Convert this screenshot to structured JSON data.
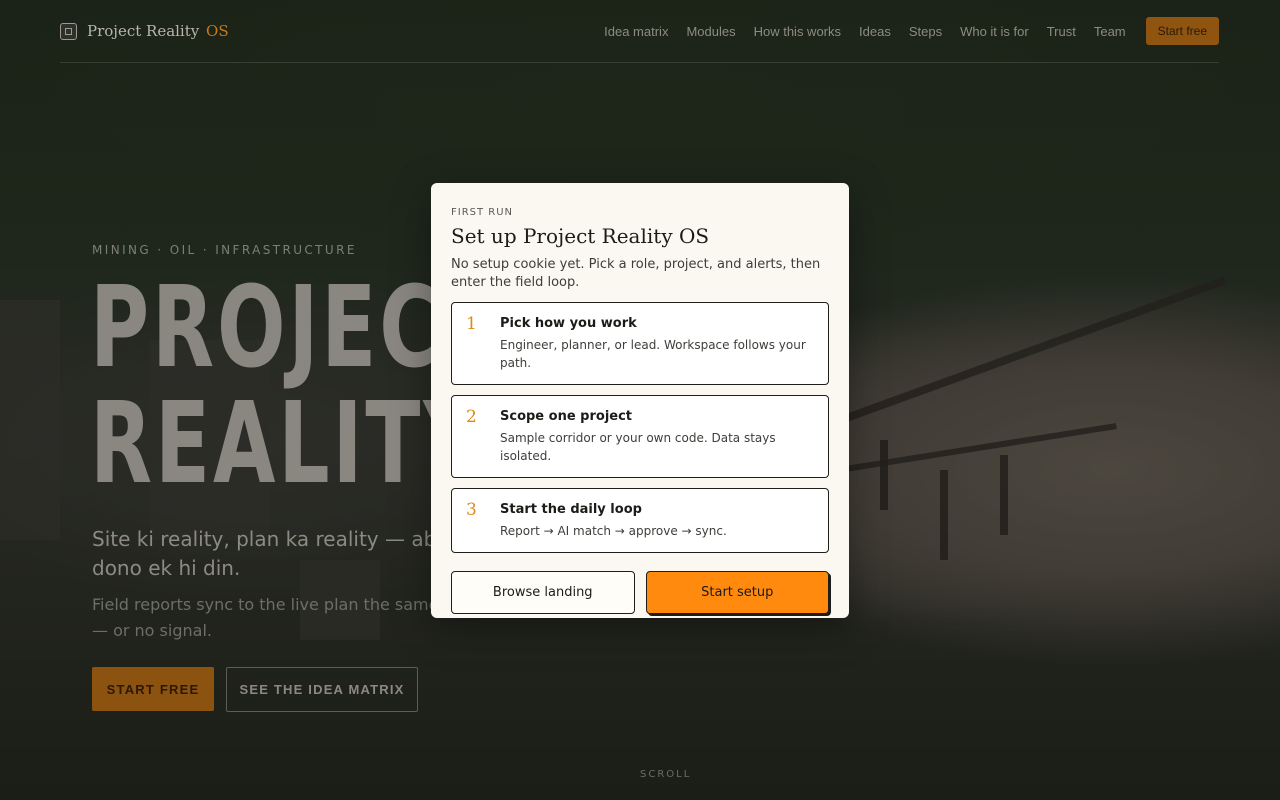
{
  "nav": {
    "brand_name": "Project Reality",
    "brand_suffix": "OS",
    "links": [
      "Idea matrix",
      "Modules",
      "How this works",
      "Ideas",
      "Steps",
      "Who it is for",
      "Trust",
      "Team"
    ],
    "cta": "Start free"
  },
  "hero": {
    "eyebrow": "MINING · OIL · INFRASTRUCTURE",
    "title_line1": "PROJECT",
    "title_line2": "REALITY",
    "tagline": "Site ki reality, plan ka reality — ab dono ek hi din.",
    "subtitle": "Field reports sync to the live plan the same day — or no signal.",
    "primary_cta": "START FREE",
    "secondary_cta": "SEE THE IDEA MATRIX",
    "scroll_hint": "SCROLL"
  },
  "modal": {
    "eyebrow": "FIRST RUN",
    "title": "Set up Project Reality OS",
    "description": "No setup cookie yet. Pick a role, project, and alerts, then enter the field loop.",
    "steps": [
      {
        "num": "1",
        "title": "Pick how you work",
        "text": "Engineer, planner, or lead. Workspace follows your path."
      },
      {
        "num": "2",
        "title": "Scope one project",
        "text": "Sample corridor or your own code. Data stays isolated."
      },
      {
        "num": "3",
        "title": "Start the daily loop",
        "text": "Report → AI match → approve → sync."
      }
    ],
    "secondary_button": "Browse landing",
    "primary_button": "Start setup"
  },
  "colors": {
    "accent": "#ff8a0d",
    "accent_dim": "#8c520f",
    "modal_bg": "#fbf8f1"
  }
}
